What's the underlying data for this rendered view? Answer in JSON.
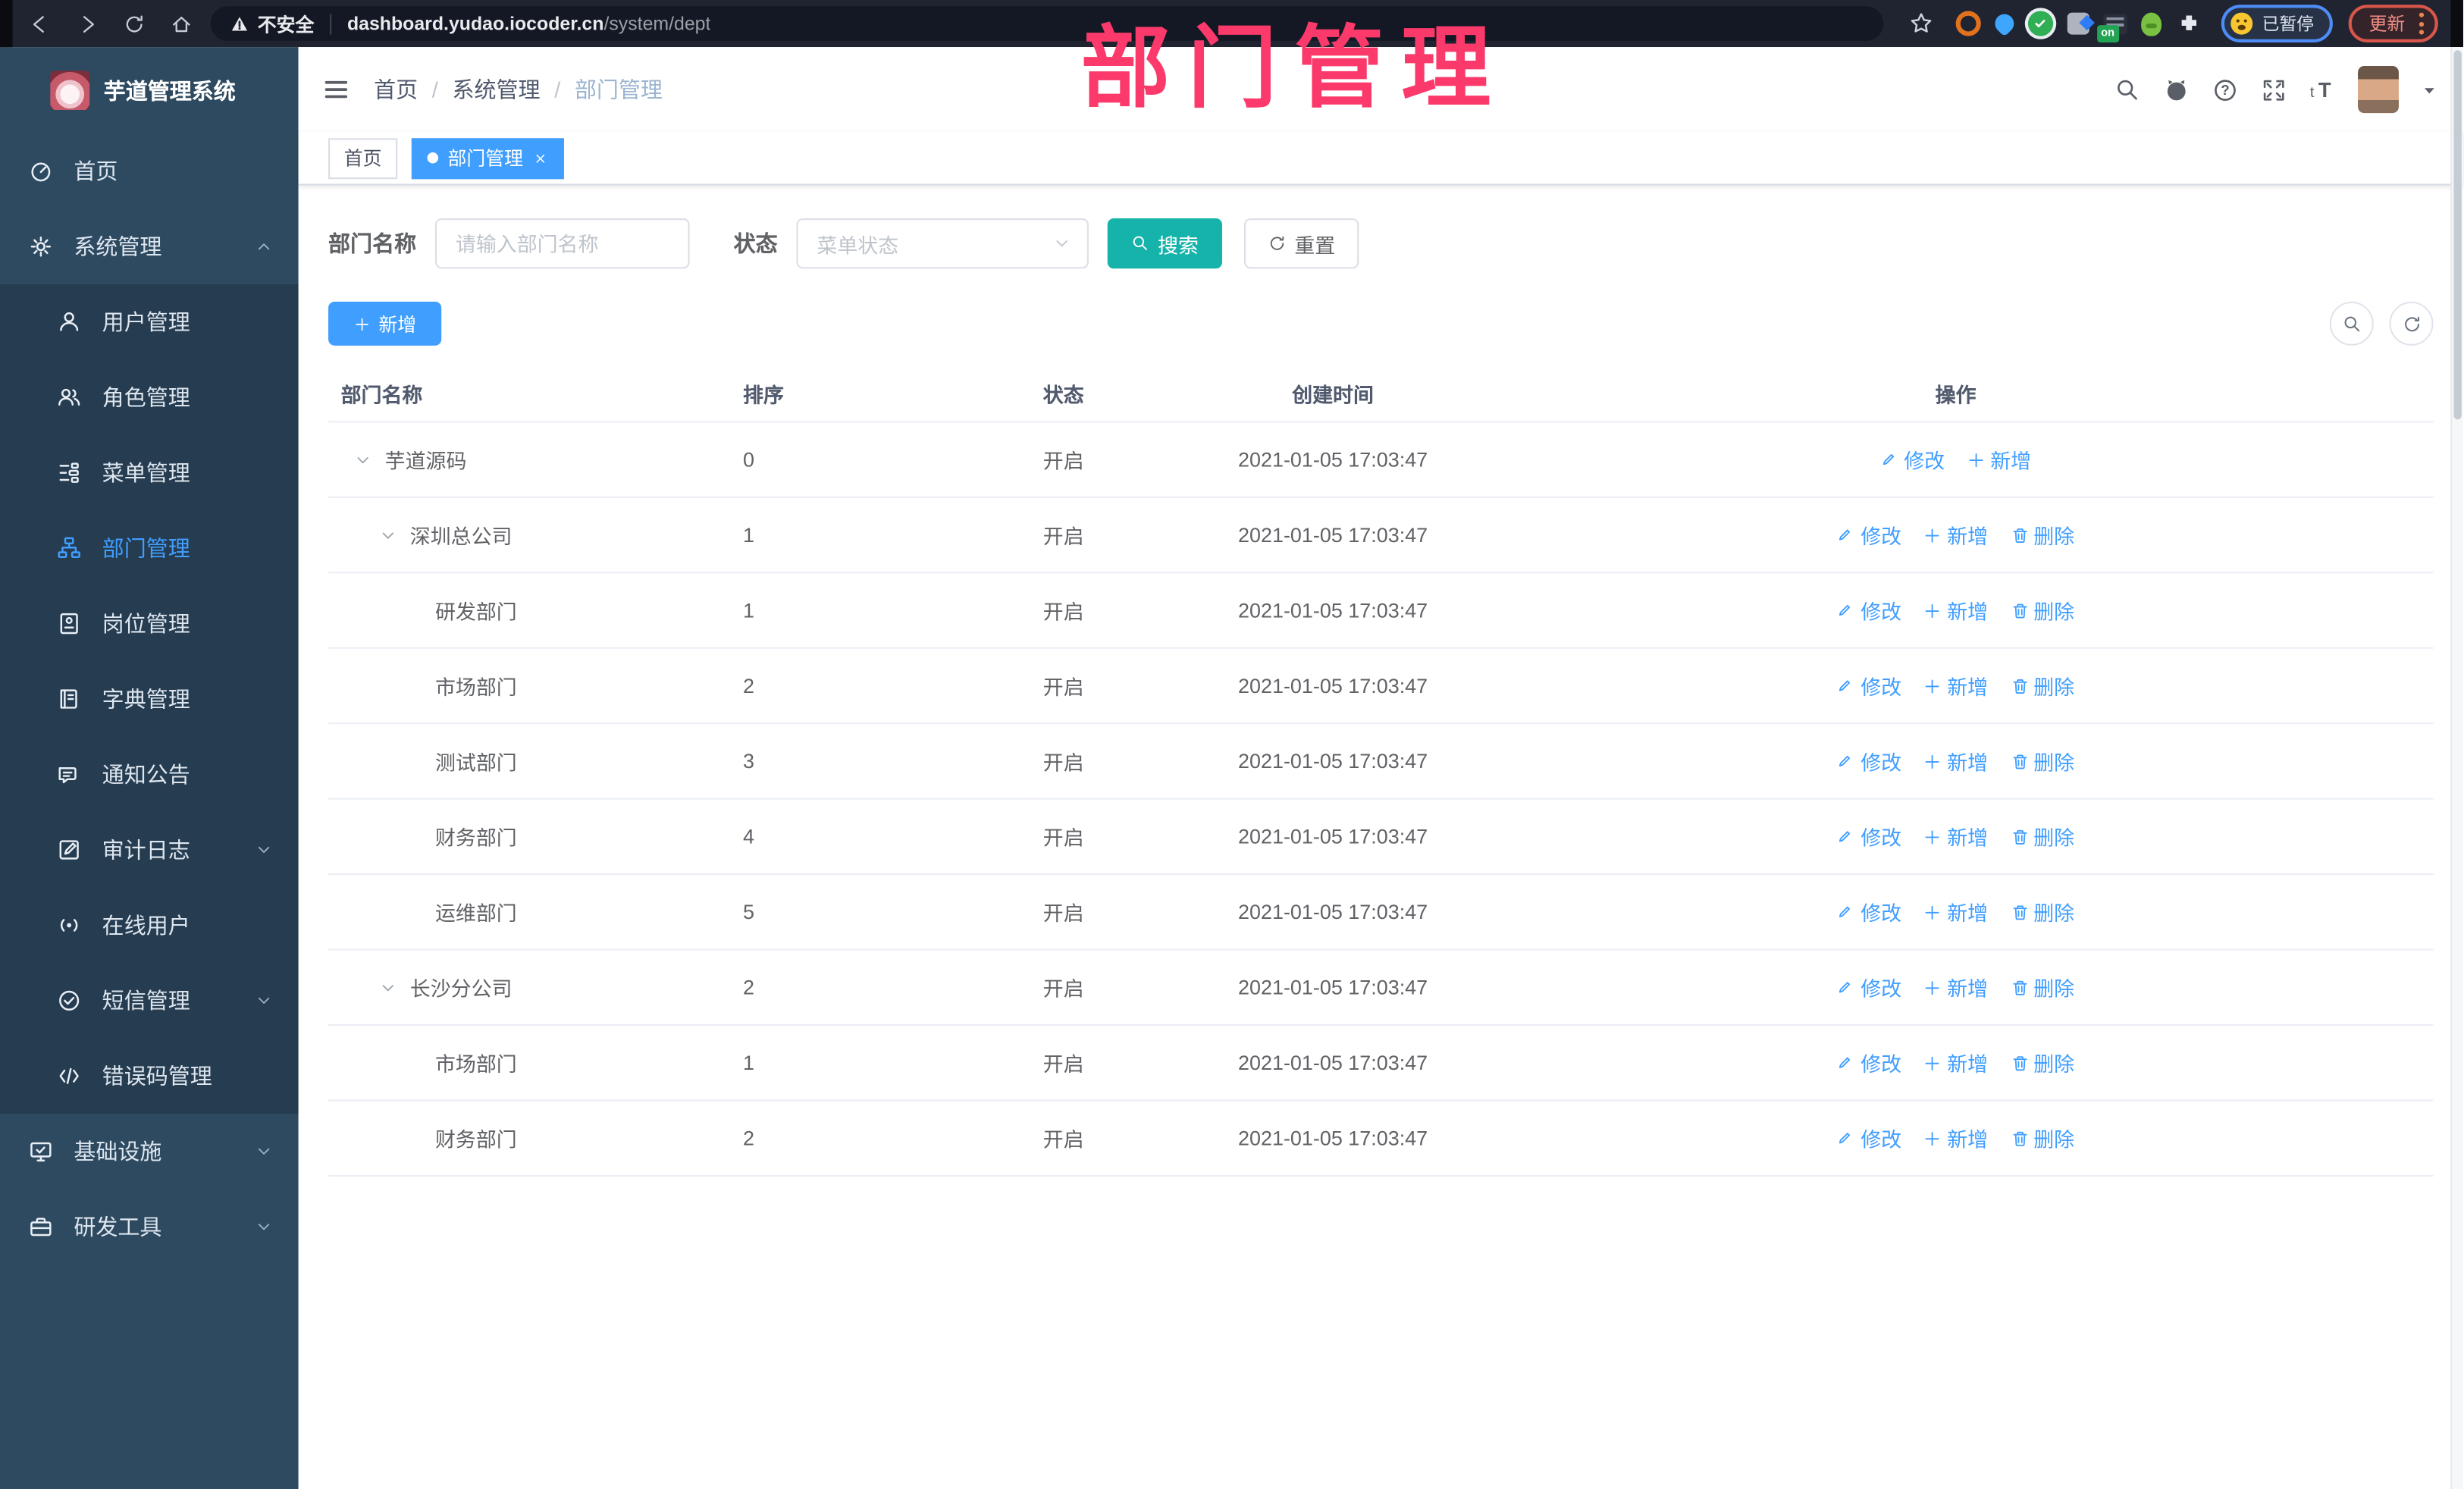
{
  "browser": {
    "security_warning": "不安全",
    "url_host": "dashboard.yudao.iocoder.cn",
    "url_path": "/system/dept",
    "paused_label": "已暂停",
    "update_label": "更新",
    "extensions": [
      {
        "kind": "ring"
      },
      {
        "kind": "pin"
      },
      {
        "kind": "check"
      },
      {
        "kind": "grid"
      },
      {
        "kind": "list",
        "badge": "on"
      },
      {
        "kind": "bot"
      },
      {
        "kind": "puzzle"
      }
    ]
  },
  "annotation": {
    "text": "部门管理"
  },
  "sidebar": {
    "app_title": "芋道管理系统",
    "items": [
      {
        "id": "home",
        "label": "首页",
        "icon": "dashboard",
        "level": 0
      },
      {
        "id": "system",
        "label": "系统管理",
        "icon": "gear",
        "level": 0,
        "chevron": "up"
      },
      {
        "id": "user",
        "label": "用户管理",
        "icon": "user",
        "level": 1
      },
      {
        "id": "role",
        "label": "角色管理",
        "icon": "users",
        "level": 1
      },
      {
        "id": "menu",
        "label": "菜单管理",
        "icon": "tree",
        "level": 1
      },
      {
        "id": "dept",
        "label": "部门管理",
        "icon": "sitemap",
        "level": 1,
        "active": true
      },
      {
        "id": "post",
        "label": "岗位管理",
        "icon": "badge",
        "level": 1
      },
      {
        "id": "dict",
        "label": "字典管理",
        "icon": "book",
        "level": 1
      },
      {
        "id": "notice",
        "label": "通知公告",
        "icon": "announce",
        "level": 1
      },
      {
        "id": "audit",
        "label": "审计日志",
        "icon": "audit",
        "level": 1,
        "chevron": "down"
      },
      {
        "id": "online",
        "label": "在线用户",
        "icon": "online",
        "level": 1
      },
      {
        "id": "sms",
        "label": "短信管理",
        "icon": "sms",
        "level": 1,
        "chevron": "down"
      },
      {
        "id": "errcode",
        "label": "错误码管理",
        "icon": "code",
        "level": 1
      },
      {
        "id": "infra",
        "label": "基础设施",
        "icon": "monitor",
        "level": 0,
        "chevron": "down"
      },
      {
        "id": "devtool",
        "label": "研发工具",
        "icon": "toolbox",
        "level": 0,
        "chevron": "down"
      }
    ]
  },
  "header": {
    "breadcrumb": [
      "首页",
      "系统管理",
      "部门管理"
    ],
    "action_icons": [
      "search",
      "github",
      "question",
      "expand",
      "fontsize"
    ]
  },
  "tabs": [
    {
      "label": "首页",
      "active": false,
      "closable": false
    },
    {
      "label": "部门管理",
      "active": true,
      "closable": true
    }
  ],
  "filters": {
    "name_label": "部门名称",
    "name_placeholder": "请输入部门名称",
    "status_label": "状态",
    "status_placeholder": "菜单状态",
    "search_label": "搜索",
    "reset_label": "重置"
  },
  "toolbar": {
    "add_label": "新增"
  },
  "table": {
    "columns": [
      "部门名称",
      "排序",
      "状态",
      "创建时间",
      "操作"
    ],
    "rows": [
      {
        "name": "芋道源码",
        "level": 0,
        "expandable": true,
        "sort": "0",
        "status": "开启",
        "created": "2021-01-05 17:03:47",
        "actions": [
          {
            "icon": "pencil",
            "label": "修改"
          },
          {
            "icon": "plus",
            "label": "新增"
          }
        ]
      },
      {
        "name": "深圳总公司",
        "level": 1,
        "expandable": true,
        "sort": "1",
        "status": "开启",
        "created": "2021-01-05 17:03:47",
        "actions": [
          {
            "icon": "pencil",
            "label": "修改"
          },
          {
            "icon": "plus",
            "label": "新增"
          },
          {
            "icon": "trash",
            "label": "删除"
          }
        ]
      },
      {
        "name": "研发部门",
        "level": 2,
        "expandable": false,
        "sort": "1",
        "status": "开启",
        "created": "2021-01-05 17:03:47",
        "actions": [
          {
            "icon": "pencil",
            "label": "修改"
          },
          {
            "icon": "plus",
            "label": "新增"
          },
          {
            "icon": "trash",
            "label": "删除"
          }
        ]
      },
      {
        "name": "市场部门",
        "level": 2,
        "expandable": false,
        "sort": "2",
        "status": "开启",
        "created": "2021-01-05 17:03:47",
        "actions": [
          {
            "icon": "pencil",
            "label": "修改"
          },
          {
            "icon": "plus",
            "label": "新增"
          },
          {
            "icon": "trash",
            "label": "删除"
          }
        ]
      },
      {
        "name": "测试部门",
        "level": 2,
        "expandable": false,
        "sort": "3",
        "status": "开启",
        "created": "2021-01-05 17:03:47",
        "actions": [
          {
            "icon": "pencil",
            "label": "修改"
          },
          {
            "icon": "plus",
            "label": "新增"
          },
          {
            "icon": "trash",
            "label": "删除"
          }
        ]
      },
      {
        "name": "财务部门",
        "level": 2,
        "expandable": false,
        "sort": "4",
        "status": "开启",
        "created": "2021-01-05 17:03:47",
        "actions": [
          {
            "icon": "pencil",
            "label": "修改"
          },
          {
            "icon": "plus",
            "label": "新增"
          },
          {
            "icon": "trash",
            "label": "删除"
          }
        ]
      },
      {
        "name": "运维部门",
        "level": 2,
        "expandable": false,
        "sort": "5",
        "status": "开启",
        "created": "2021-01-05 17:03:47",
        "actions": [
          {
            "icon": "pencil",
            "label": "修改"
          },
          {
            "icon": "plus",
            "label": "新增"
          },
          {
            "icon": "trash",
            "label": "删除"
          }
        ]
      },
      {
        "name": "长沙分公司",
        "level": 1,
        "expandable": true,
        "sort": "2",
        "status": "开启",
        "created": "2021-01-05 17:03:47",
        "actions": [
          {
            "icon": "pencil",
            "label": "修改"
          },
          {
            "icon": "plus",
            "label": "新增"
          },
          {
            "icon": "trash",
            "label": "删除"
          }
        ]
      },
      {
        "name": "市场部门",
        "level": 2,
        "expandable": false,
        "sort": "1",
        "status": "开启",
        "created": "2021-01-05 17:03:47",
        "actions": [
          {
            "icon": "pencil",
            "label": "修改"
          },
          {
            "icon": "plus",
            "label": "新增"
          },
          {
            "icon": "trash",
            "label": "删除"
          }
        ]
      },
      {
        "name": "财务部门",
        "level": 2,
        "expandable": false,
        "sort": "2",
        "status": "开启",
        "created": "2021-01-05 17:03:47",
        "actions": [
          {
            "icon": "pencil",
            "label": "修改"
          },
          {
            "icon": "plus",
            "label": "新增"
          },
          {
            "icon": "trash",
            "label": "删除"
          }
        ]
      }
    ]
  },
  "colors": {
    "accent": "#409eff",
    "search_button": "#16b3ab",
    "annotation": "#fb3a6b",
    "sidebar_bg": "#2e4a60",
    "submenu_bg": "#263c50"
  }
}
